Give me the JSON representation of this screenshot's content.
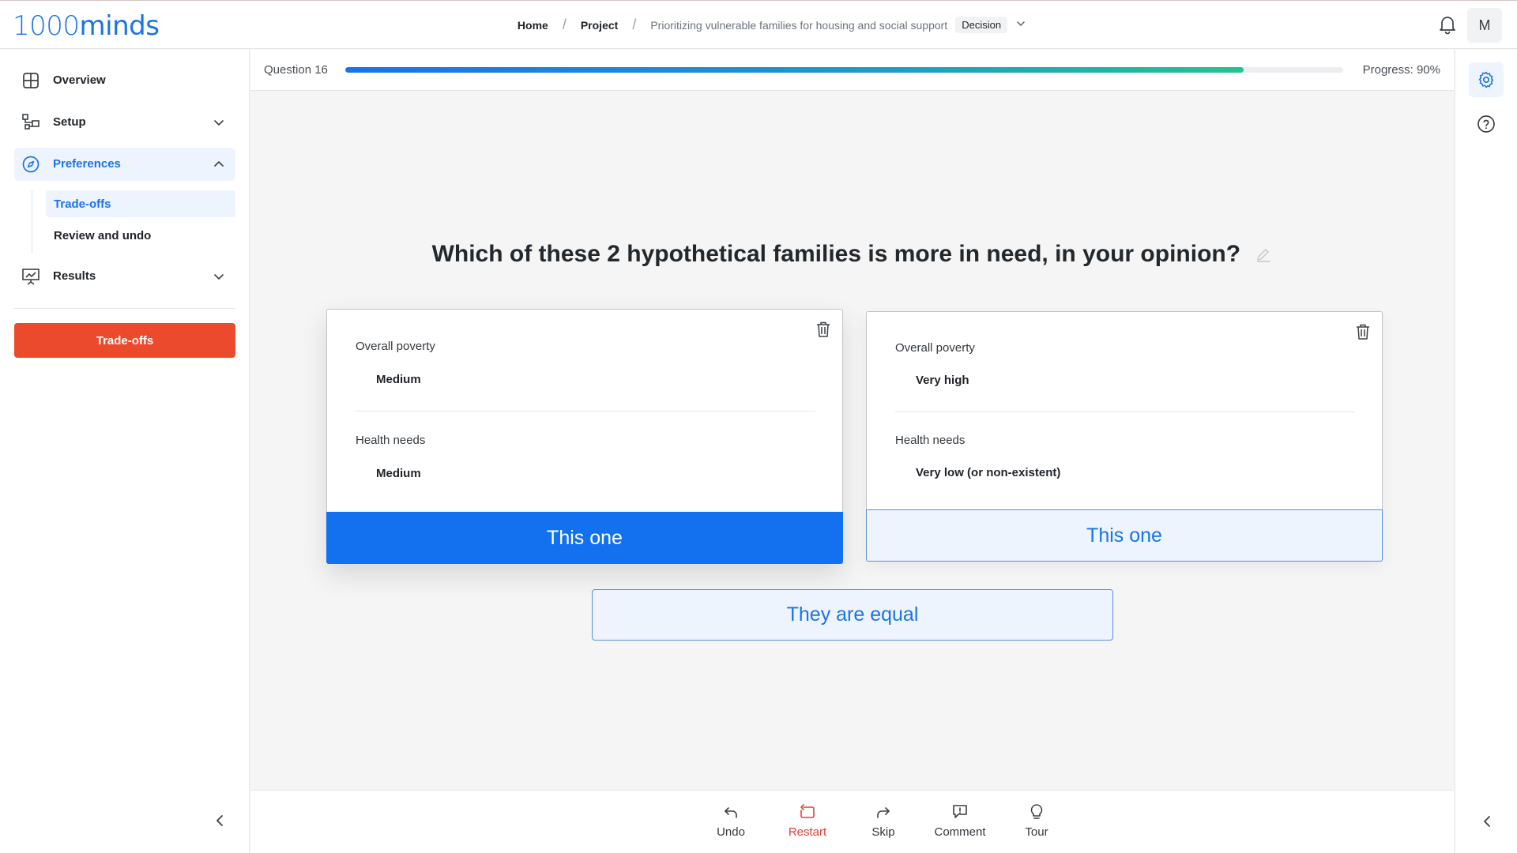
{
  "app": {
    "logo_num": "1000",
    "logo_text": "minds",
    "avatar_initial": "M"
  },
  "breadcrumb": {
    "home": "Home",
    "project": "Project",
    "current": "Prioritizing vulnerable families for housing and social support",
    "badge": "Decision"
  },
  "sidebar": {
    "overview": "Overview",
    "setup": "Setup",
    "preferences": "Preferences",
    "sub_tradeoffs": "Trade-offs",
    "sub_review": "Review and undo",
    "results": "Results",
    "cta": "Trade-offs"
  },
  "progress": {
    "question_label": "Question 16",
    "text": "Progress: 90%",
    "value": 0.9
  },
  "question": "Which of these 2 hypothetical families is more in need, in your opinion?",
  "cards": [
    {
      "attr1": "Overall poverty",
      "val1": "Medium",
      "attr2": "Health needs",
      "val2": "Medium",
      "button": "This one"
    },
    {
      "attr1": "Overall poverty",
      "val1": "Very high",
      "attr2": "Health needs",
      "val2": "Very low (or non-existent)",
      "button": "This one"
    }
  ],
  "equal_button": "They are equal",
  "footer": {
    "undo": "Undo",
    "restart": "Restart",
    "skip": "Skip",
    "comment": "Comment",
    "tour": "Tour"
  },
  "colors": {
    "accent": "#1a73e8",
    "cta": "#eb4a2d",
    "danger": "#e0403a"
  },
  "icons": [
    "bell-icon",
    "overview-icon",
    "setup-icon",
    "compass-icon",
    "results-icon",
    "gear-icon",
    "help-icon",
    "trash-icon",
    "pencil-icon",
    "undo-icon",
    "restart-icon",
    "skip-icon",
    "comment-icon",
    "lightbulb-icon",
    "chevron-left-icon"
  ]
}
